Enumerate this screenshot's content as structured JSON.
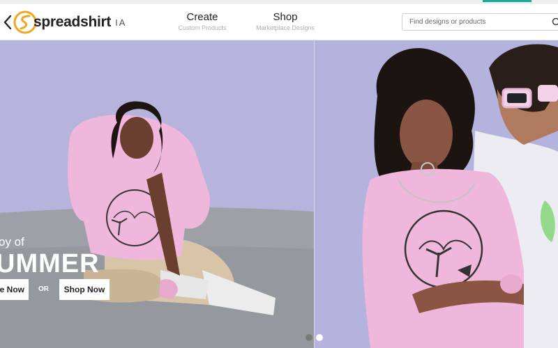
{
  "header": {
    "logo_brand": "spreadshirt",
    "logo_suffix": "IA",
    "nav": [
      {
        "title": "Create",
        "subtitle": "Custom Products"
      },
      {
        "title": "Shop",
        "subtitle": "Marketplace Designs"
      }
    ],
    "search": {
      "placeholder": "Find designs or products",
      "value": ""
    }
  },
  "hero": {
    "kicker": "oy of",
    "headline": "UMMER",
    "create_button": "e Now",
    "or_label": "OR",
    "shop_button": "Shop Now"
  },
  "carousel": {
    "count": 2,
    "active": 1
  },
  "colors": {
    "accent": "#1aa99a",
    "logo_orange": "#f2a620",
    "hero_background": "#b8b6dd",
    "tshirt_pink": "#f0b7dc"
  },
  "icons": [
    "back-chevron-icon",
    "logo-mark-icon",
    "search-icon"
  ]
}
